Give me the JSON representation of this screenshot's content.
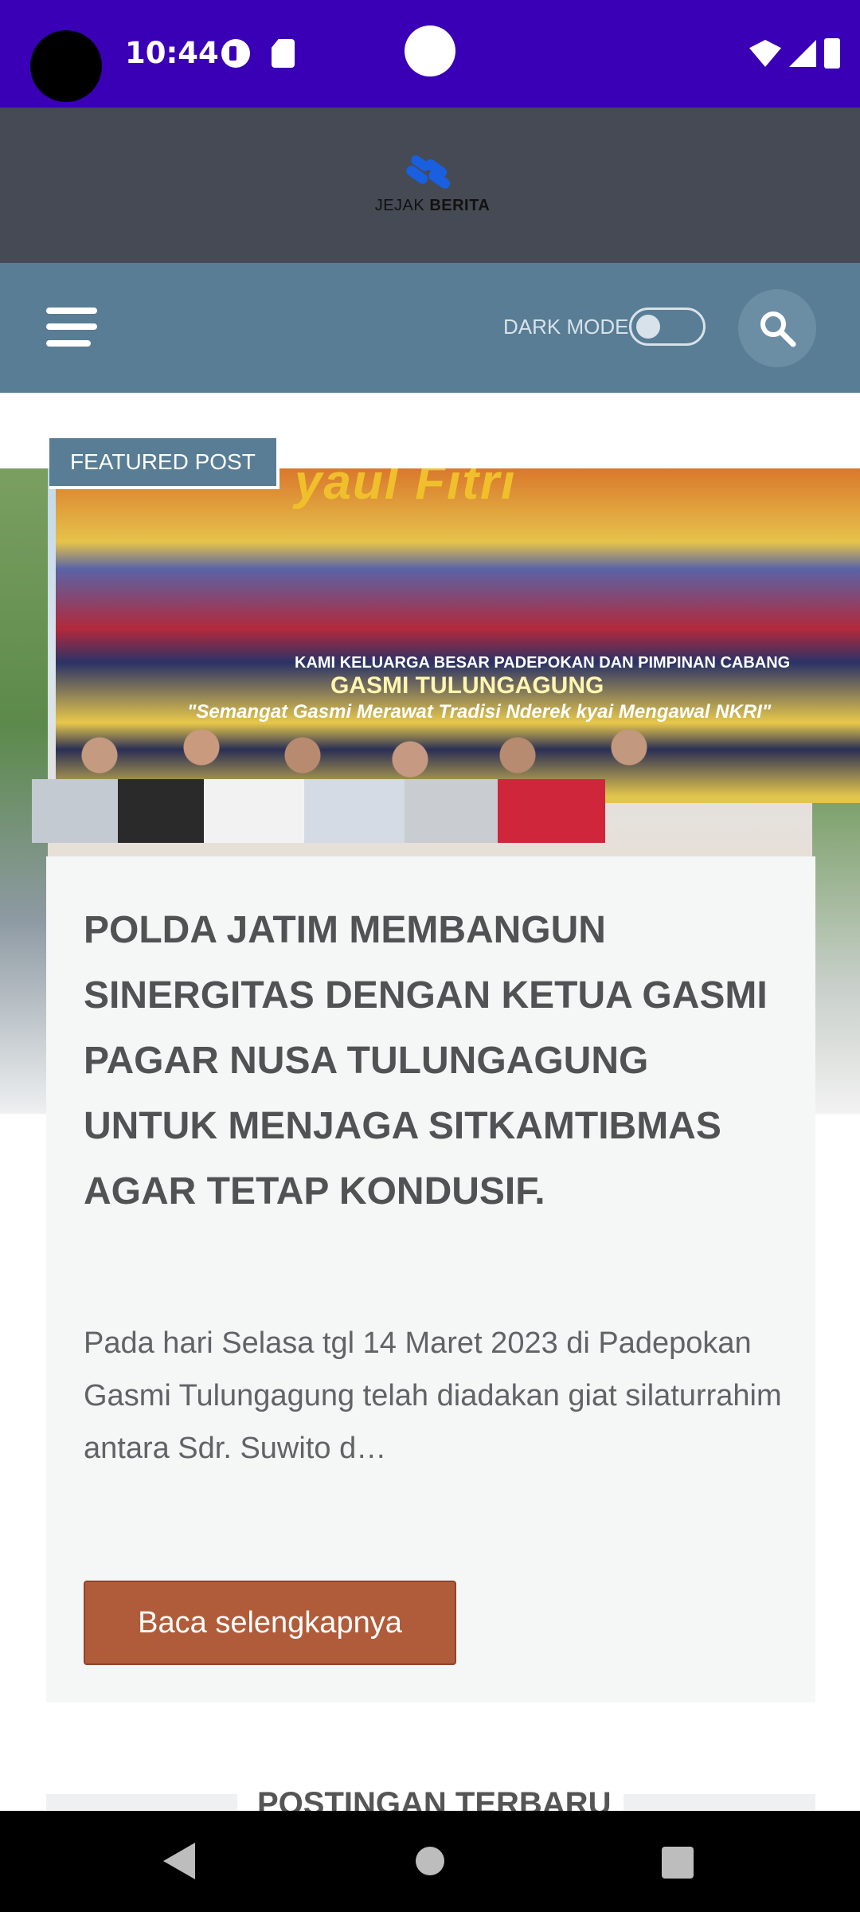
{
  "status_bar": {
    "time": "10:44"
  },
  "header": {
    "logo_text_regular": "JEJAK",
    "logo_text_bold": "BERITA"
  },
  "nav": {
    "dark_mode_label": "DARK MODE",
    "dark_mode_enabled": false
  },
  "featured": {
    "badge": "FEATURED POST",
    "image_banner_title": "yaul Fitri",
    "image_banner_line1": "KAMI KELUARGA BESAR PADEPOKAN DAN PIMPINAN CABANG",
    "image_banner_line2": "GASMI TULUNGAGUNG",
    "image_banner_line3": "\"Semangat Gasmi Merawat Tradisi Nderek kyai Mengawal NKRI\"",
    "title": "POLDA JATIM MEMBANGUN SINERGITAS DENGAN KETUA GASMI PAGAR NUSA TULUNGAGUNG UNTUK MENJAGA SITKAMTIBMAS AGAR TETAP KONDUSIF.",
    "excerpt": "Pada hari Selasa tgl 14 Maret 2023 di Padepokan Gasmi Tulungagung telah diadakan giat silaturrahim antara Sdr. Suwito d…",
    "read_more": "Baca selengkapnya"
  },
  "latest": {
    "heading": "POSTINGAN TERBARU"
  },
  "colors": {
    "status_bar": "#3a00b5",
    "header_bg": "#454a54",
    "nav_bg": "#587d94",
    "button": "#b05c3a",
    "logo_blue": "#1a5fe0"
  }
}
